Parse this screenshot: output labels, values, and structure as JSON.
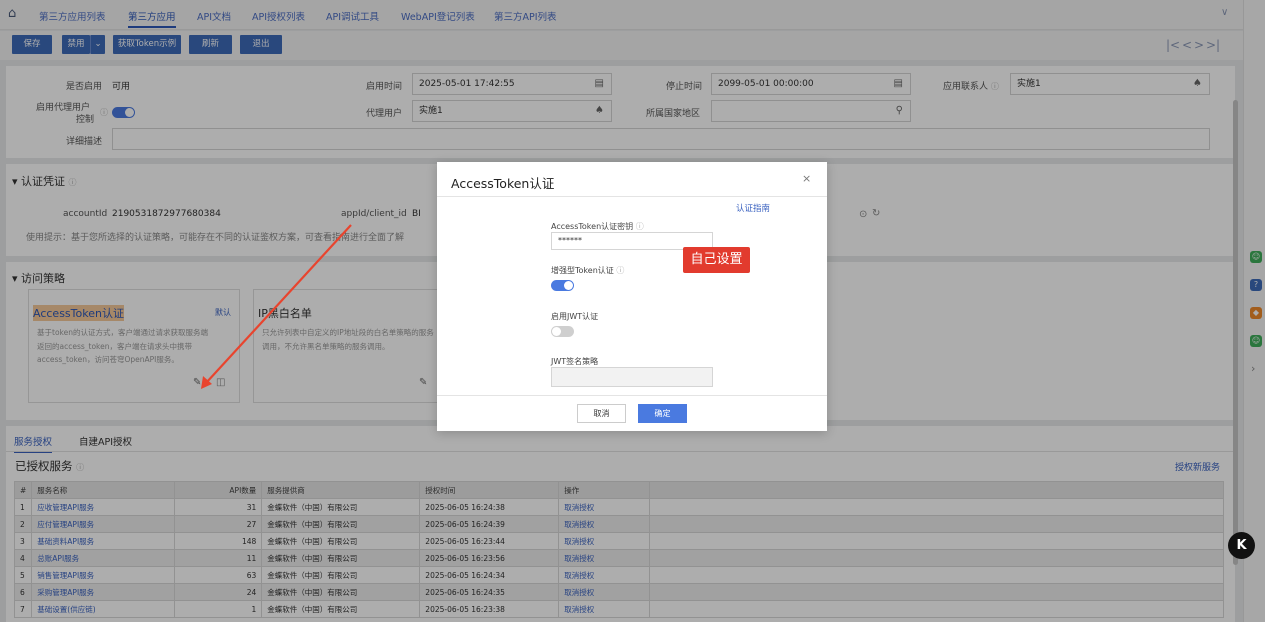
{
  "nav": {
    "home_icon": "home-icon",
    "tabs": [
      "第三方应用列表",
      "第三方应用",
      "API文档",
      "API授权列表",
      "API调试工具",
      "WebAPI登记列表",
      "第三方API列表"
    ],
    "collapse_icon": "chevrons-down-icon"
  },
  "toolbar": {
    "save": "保存",
    "disable": "禁用",
    "get_token_example": "获取Token示例",
    "refresh": "刷新",
    "exit": "退出",
    "pager": [
      "|<",
      "<",
      ">",
      ">|"
    ]
  },
  "form": {
    "enabled_label": "是否启用",
    "enabled_value": "可用",
    "start_time_label": "启用时间",
    "start_time_value": "2025-05-01 17:42:55",
    "stop_time_label": "停止时间",
    "stop_time_value": "2099-05-01 00:00:00",
    "contact_label": "应用联系人",
    "contact_value": "实施1",
    "proxy_ctrl_label_1": "启用代理用户",
    "proxy_ctrl_label_2": "控制",
    "proxy_user_label": "代理用户",
    "proxy_user_value": "实施1",
    "region_label": "所属国家地区",
    "region_value": "",
    "desc_label": "详细描述",
    "desc_value": ""
  },
  "credential": {
    "title": "认证凭证",
    "account_label": "accountId",
    "account_value": "2190531872977680384",
    "appid_label": "appId/client_id",
    "appid_value": "BI",
    "tip": "使用提示：基于您所选择的认证策略，可能存在不同的认证鉴权方案，可查看指南进行全面了解"
  },
  "policy": {
    "title": "访问策略",
    "card1": {
      "title": "AccessToken认证",
      "badge": "默认",
      "desc": [
        "基于token的认证方式，客户端通过请求获取服务端",
        "返回的access_token，客户端在请求头中携带",
        "access_token，访问苍穹OpenAPI服务。"
      ]
    },
    "card2": {
      "title": "IP黑白名单",
      "desc": [
        "只允许列表中自定义的IP地址段的白名单策略的服务",
        "调用，不允许黑名单策略的服务调用。"
      ]
    }
  },
  "services": {
    "tabs": [
      "服务授权",
      "自建API授权"
    ],
    "title": "已授权服务",
    "add_link": "授权新服务",
    "columns": [
      "#",
      "服务名称",
      "API数量",
      "服务提供商",
      "授权时间",
      "操作"
    ],
    "rows": [
      [
        "1",
        "应收管理API服务",
        "31",
        "金蝶软件（中国）有限公司",
        "2025-06-05 16:24:38",
        "取消授权"
      ],
      [
        "2",
        "应付管理API服务",
        "27",
        "金蝶软件（中国）有限公司",
        "2025-06-05 16:24:39",
        "取消授权"
      ],
      [
        "3",
        "基础资料API服务",
        "148",
        "金蝶软件（中国）有限公司",
        "2025-06-05 16:23:44",
        "取消授权"
      ],
      [
        "4",
        "总账API服务",
        "11",
        "金蝶软件（中国）有限公司",
        "2025-06-05 16:23:56",
        "取消授权"
      ],
      [
        "5",
        "销售管理API服务",
        "63",
        "金蝶软件（中国）有限公司",
        "2025-06-05 16:24:34",
        "取消授权"
      ],
      [
        "6",
        "采购管理API服务",
        "24",
        "金蝶软件（中国）有限公司",
        "2025-06-05 16:24:35",
        "取消授权"
      ],
      [
        "7",
        "基础设置(供应链)",
        "1",
        "金蝶软件（中国）有限公司",
        "2025-06-05 16:23:38",
        "取消授权"
      ]
    ]
  },
  "dialog": {
    "title": "AccessToken认证",
    "guide_link": "认证指南",
    "secret_label": "AccessToken认证密钥",
    "secret_value": "******",
    "enhanced_label": "增强型Token认证",
    "jwt_label": "启用JWT认证",
    "jwt_policy_label": "JWT签名策略",
    "cancel": "取消",
    "ok": "确定"
  },
  "annotation": {
    "label": "自己设置",
    "color": "#e23b2e"
  },
  "colors": {
    "primary": "#3d6ab8",
    "link": "#3a62c0",
    "toggle_on": "#4a7ae0",
    "annotation": "#e23b2e"
  }
}
